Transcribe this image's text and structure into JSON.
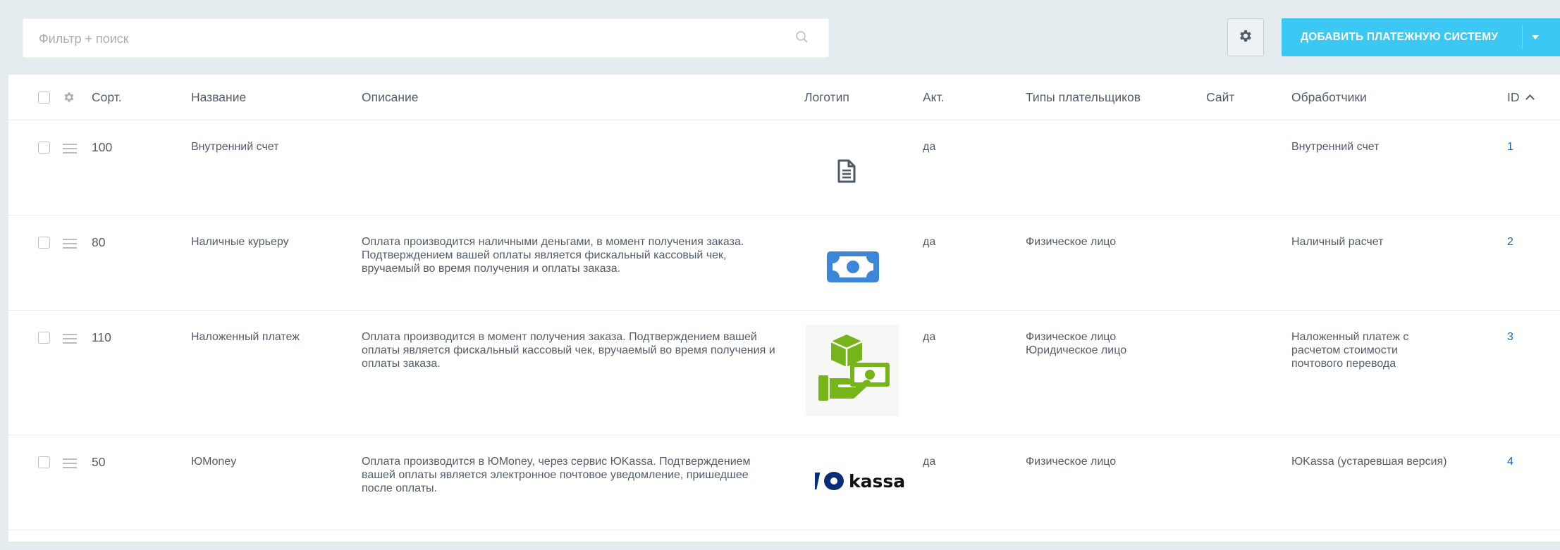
{
  "toolbar": {
    "filter_placeholder": "Фильтр + поиск",
    "add_button_label": "ДОБАВИТЬ ПЛАТЕЖНУЮ СИСТЕМУ",
    "accent_color": "#3bc8f5"
  },
  "columns": {
    "sort": "Сорт.",
    "name": "Название",
    "description": "Описание",
    "logo": "Логотип",
    "active": "Акт.",
    "payer_types": "Типы плательщиков",
    "site": "Сайт",
    "handlers": "Обработчики",
    "id": "ID"
  },
  "rows": [
    {
      "sort": "100",
      "name": "Внутренний счет",
      "description": "",
      "logo": "document-icon",
      "active": "да",
      "payer_types": "",
      "handler": "Внутренний счет",
      "id": "1"
    },
    {
      "sort": "80",
      "name": "Наличные курьеру",
      "description": "Оплата производится наличными деньгами, в момент получения заказа. Подтверждением вашей оплаты является фискальный кассовый чек, вручаемый во время получения и оплаты заказа.",
      "logo": "cash-bill-icon",
      "active": "да",
      "payer_types": "Физическое лицо",
      "handler": "Наличный расчет",
      "id": "2"
    },
    {
      "sort": "110",
      "name": "Наложенный платеж",
      "description": "Оплата производится в момент получения заказа. Подтверждением вашей оплаты является фискальный кассовый чек, вручаемый во время получения и оплаты заказа.",
      "logo": "cash-on-delivery-icon",
      "active": "да",
      "payer_types": "Физическое лицо\nЮридическое лицо",
      "handler": "Наложенный платеж с расчетом стоимости почтового перевода",
      "id": "3"
    },
    {
      "sort": "50",
      "name": "ЮMoney",
      "description": "Оплата производится в ЮMoney, через сервис ЮKassa. Подтверждением вашей оплаты является электронное почтовое уведомление, пришедшее после оплаты.",
      "logo": "yookassa-logo",
      "logo_text": "kassa",
      "active": "да",
      "payer_types": "Физическое лицо",
      "handler": "ЮKassa (устаревшая версия)",
      "id": "4"
    }
  ]
}
